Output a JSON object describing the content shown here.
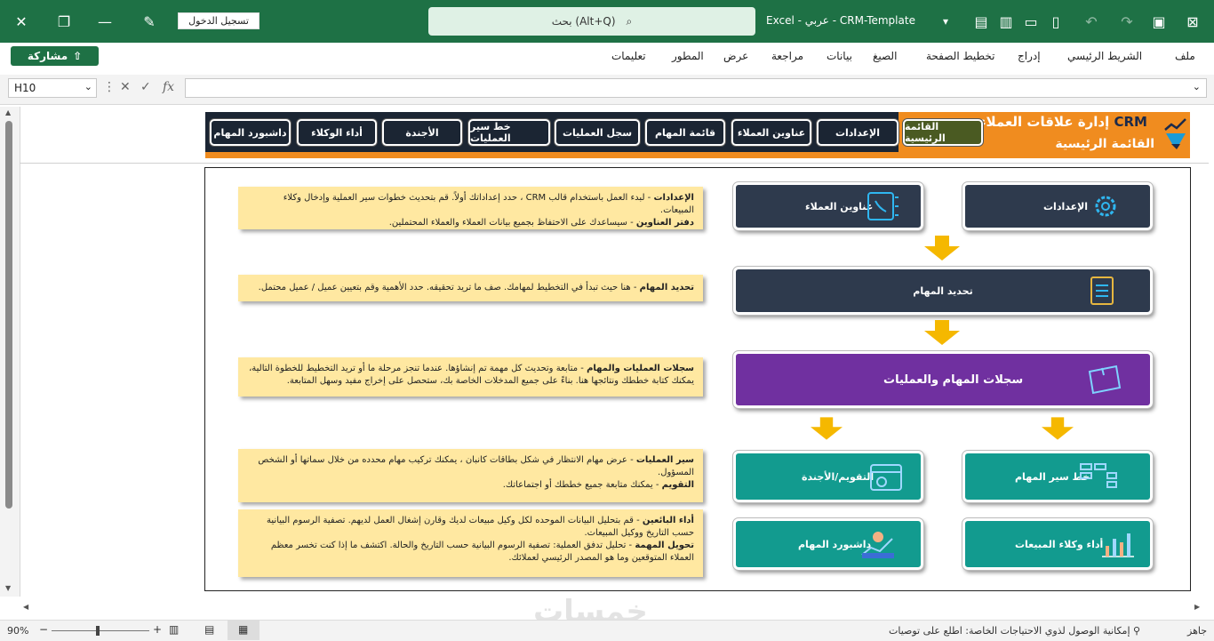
{
  "titlebar": {
    "signin_label": "تسجيل الدخول",
    "search_text": "بحث (Alt+Q)",
    "app_name": "Excel",
    "language": "عربي",
    "file_name": "CRM-Template"
  },
  "ribbon": {
    "share_label": "مشاركة",
    "tabs": [
      "ملف",
      "الشريط الرئيسي",
      "إدراج",
      "تخطيط الصفحة",
      "الصيغ",
      "بيانات",
      "مراجعة",
      "عرض",
      "المطور",
      "تعليمات"
    ]
  },
  "formula_bar": {
    "cell_ref": "H10",
    "formula": ""
  },
  "header": {
    "title_prefix": "إدارة علاقات العملاء",
    "title_brand": "CRM",
    "subtitle": "القائمة الرئيسية",
    "nav": [
      "القائمة الرئيسية",
      "الإعدادات",
      "عناوين العملاء",
      "قائمة المهام",
      "سجل العمليات",
      "خط سير العمليات",
      "الأجندة",
      "أداء الوكلاء",
      "داشبورد المهام"
    ]
  },
  "cards": {
    "settings": "الإعدادات",
    "addresses": "عناوين العملاء",
    "tasks": "تحديد المهام",
    "records": "سجلات المهام والعمليات",
    "pipeline": "خط سير المهام",
    "calendar": "التقويم/الأجندة",
    "agents": "أداء وكلاء المبيعات",
    "dashboard": "داشبورد المهام"
  },
  "notes": {
    "n1_b1": "الإعدادات",
    "n1_t1": " - لبدء العمل باستخدام قالب CRM ، حدد إعداداتك أولاً. قم بتحديث خطوات سير العملية وإدخال وكلاء المبيعات.",
    "n1_b2": "دفتر العناوين",
    "n1_t2": " - سيساعدك على الاحتفاظ بجميع بيانات العملاء والعملاء المحتملين.",
    "n2_b1": "تحديد المهام",
    "n2_t1": " - هنا حيث تبدأ في التخطيط لمهامك. صف ما تريد تحقيقه. حدد الأهمية وقم بتعيين عميل / عميل محتمل.",
    "n3_b1": "سجلات العمليات والمهام",
    "n3_t1": " - متابعة وتحديث كل مهمة تم إنشاؤها. عندما تنجز مرحلة ما أو تريد التخطيط للخطوة التالية، يمكنك كتابة خططك ونتائجها هنا. بناءً على جميع المدخلات الخاصة بك، ستحصل على إخراج مفيد وسهل المتابعة.",
    "n4_b1": "سير العمليات",
    "n4_t1": " - عرض مهام الانتظار في شكل بطاقات كانبان ، يمكنك تركيب مهام محدده من خلال سماتها أو الشخص المسؤول.",
    "n4_b2": "التقويم",
    "n4_t2": " - يمكنك متابعة جميع خططك أو اجتماعاتك.",
    "n5_b1": "أداء البائعين",
    "n5_t1": " - قم بتحليل البيانات الموحده لكل وكيل مبيعات لديك وقارن إشغال العمل لديهم. تصفية الرسوم البيانية حسب التاريخ ووكيل المبيعات.",
    "n5_b2": "تحويل المهمة",
    "n5_t2": " - تحليل تدفق العملية: تصفية الرسوم البيانية حسب التاريخ والحالة. اكتشف ما إذا كنت تخسر معظم العملاء المتوقعين وما هو المصدر الرئيسي لعملائك."
  },
  "statusbar": {
    "ready": "جاهز",
    "accessibility": "إمكانية الوصول لذوي الاحتياجات الخاصة: اطلع على توصيات",
    "zoom": "90%"
  },
  "watermark": "خمسات",
  "colors": {
    "excel_green": "#1e7145",
    "orange": "#f08c1f",
    "navy": "#1b2533",
    "purple": "#7030a0",
    "teal": "#129b8f",
    "note": "#ffe8a1",
    "arrow": "#f5b800"
  }
}
